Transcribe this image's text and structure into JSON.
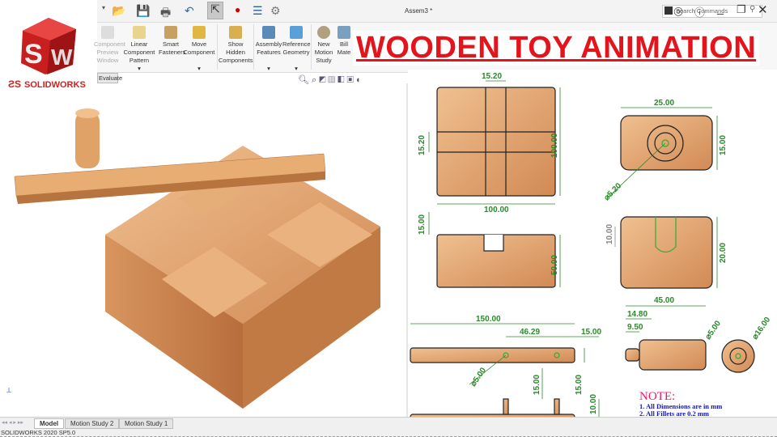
{
  "window": {
    "doc_title": "Assem3 *",
    "search_placeholder": "Search Commands"
  },
  "logo": {
    "brand": "SOLIDWORKS",
    "cube_letters": "SW"
  },
  "ribbon": [
    {
      "label": "Component Preview Window"
    },
    {
      "label": "Linear Component Pattern"
    },
    {
      "label": "Smart Fasteners"
    },
    {
      "label": "Move Component"
    },
    {
      "label": "Show Hidden Components"
    },
    {
      "label": "Assembly Features"
    },
    {
      "label": "Reference Geometry"
    },
    {
      "label": "New Motion Study"
    },
    {
      "label": "Bill Mate"
    }
  ],
  "cmd_tab": "Evaluate",
  "headline": "WOODEN TOY ANIMATION",
  "dims": {
    "base_top_w": "15.20",
    "base_left": "15.20",
    "base_right": "100.00",
    "base_bottom": "100.00",
    "base_front_left": "15.00",
    "base_front_right": "50.00",
    "head_w": "25.00",
    "head_h": "15.00",
    "head_dia": "⌀5.20",
    "peg_left": "10.00",
    "peg_right": "20.00",
    "peg_len": "45.00",
    "peg_a": "14.80",
    "peg_b": "9.50",
    "peg_dia1": "⌀5.00",
    "peg_dia2": "⌀16.00",
    "bar_len": "150.00",
    "bar_hole": "46.29",
    "bar_end": "15.00",
    "bar_dia": "⌀5.00",
    "bar_h1": "15.00",
    "bar_h2": "15.00",
    "bar_h3": "10.00"
  },
  "note": {
    "title": "NOTE:",
    "items": [
      "1.  All Dimensions are in mm",
      "2.  All Fillets are 0.2 mm"
    ]
  },
  "bottom_tabs": [
    "Model",
    "Motion Study 2",
    "Motion Study 1"
  ],
  "status": "SOLIDWORKS 2020 SP5.0",
  "colors": {
    "accent": "#e3141b",
    "dim": "#1a8a1a",
    "wood": "#dda070",
    "note_title": "#e8196e",
    "note_text": "#1515c8"
  }
}
